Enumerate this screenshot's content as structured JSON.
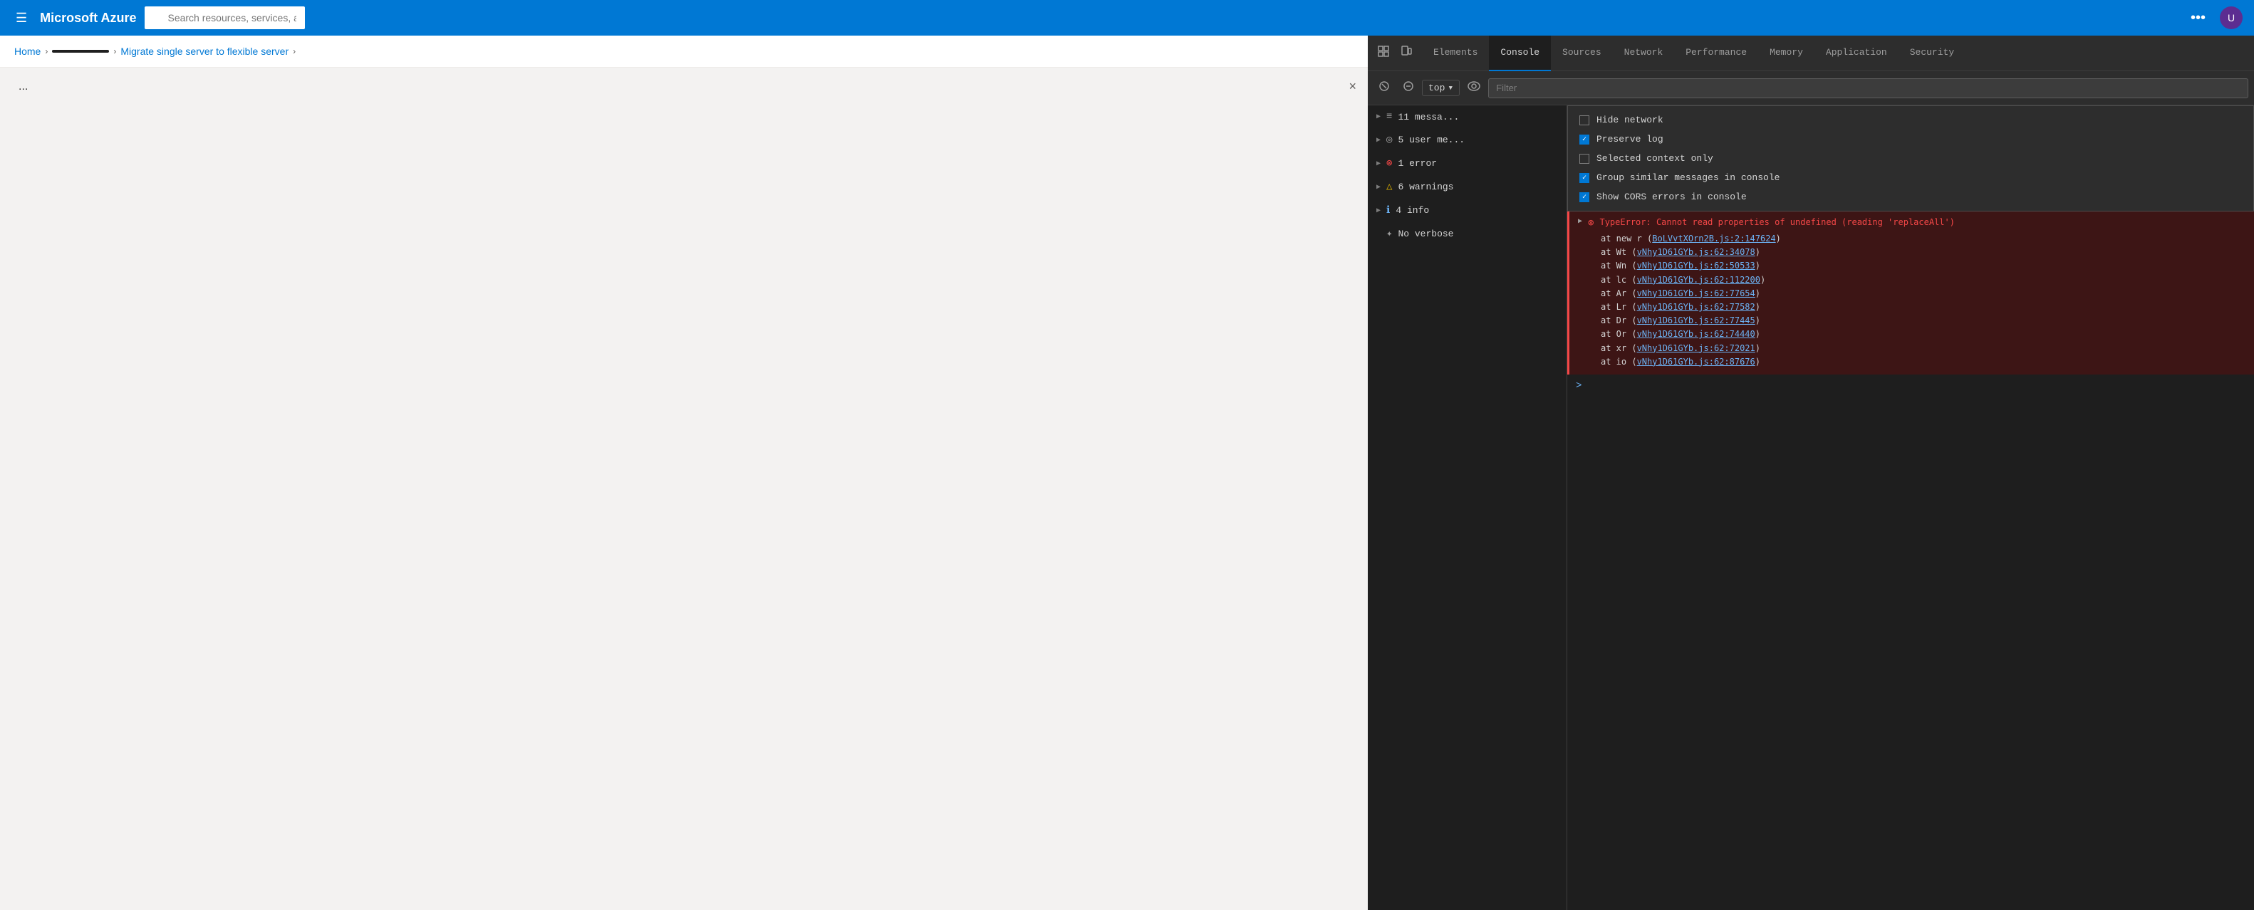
{
  "azure": {
    "topbar": {
      "logo": "Microsoft Azure",
      "search_placeholder": "Search resources, services, and docs (G+/)",
      "more_icon": "•••",
      "avatar_text": "U"
    },
    "breadcrumb": {
      "home": "Home",
      "resource": "[redacted]",
      "page": "Migrate single server to flexible server"
    },
    "page": {
      "ellipsis": "...",
      "close_label": "×"
    }
  },
  "devtools": {
    "tabs": [
      {
        "id": "elements",
        "label": "Elements"
      },
      {
        "id": "console",
        "label": "Console",
        "active": true
      },
      {
        "id": "sources",
        "label": "Sources"
      },
      {
        "id": "network",
        "label": "Network"
      },
      {
        "id": "performance",
        "label": "Performance"
      },
      {
        "id": "memory",
        "label": "Memory"
      },
      {
        "id": "application",
        "label": "Application"
      },
      {
        "id": "security",
        "label": "Security"
      }
    ],
    "toolbar": {
      "top_label": "top",
      "filter_placeholder": "Filter"
    },
    "sidebar_items": [
      {
        "id": "messages",
        "icon": "≡",
        "icon_type": "messages",
        "label": "11 messa..."
      },
      {
        "id": "user",
        "icon": "◎",
        "icon_type": "user",
        "label": "5 user me..."
      },
      {
        "id": "error",
        "icon": "⊗",
        "icon_type": "error",
        "label": "1 error"
      },
      {
        "id": "warning",
        "icon": "△",
        "icon_type": "warning",
        "label": "6 warnings"
      },
      {
        "id": "info",
        "icon": "ℹ",
        "icon_type": "info",
        "label": "4 info"
      },
      {
        "id": "verbose",
        "icon": "✦",
        "icon_type": "verbose",
        "label": "No verbose"
      }
    ],
    "dropdown": {
      "items": [
        {
          "id": "hide-network",
          "label": "Hide network",
          "checked": false
        },
        {
          "id": "preserve-log",
          "label": "Preserve log",
          "checked": true
        },
        {
          "id": "selected-context",
          "label": "Selected context only",
          "checked": false
        },
        {
          "id": "group-similar",
          "label": "Group similar messages in console",
          "checked": true
        },
        {
          "id": "show-cors",
          "label": "Show CORS errors in console",
          "checked": true
        }
      ]
    },
    "error": {
      "message": "TypeError: Cannot read properties of undefined (reading 'replaceAll')",
      "stack": [
        {
          "prefix": "at new r ",
          "link": "BoLVvtXOrn2B.js:2:147624",
          "link_text": "BoLVvtXOrn2B.js:2:147624"
        },
        {
          "prefix": "at Wt ",
          "link": "vNhy1D61GYb.js:62:34078",
          "link_text": "vNhy1D61GYb.js:62:34078"
        },
        {
          "prefix": "at Wn ",
          "link": "vNhy1D61GYb.js:62:50533",
          "link_text": "vNhy1D61GYb.js:62:50533"
        },
        {
          "prefix": "at lc ",
          "link": "vNhy1D61GYb.js:62:112200",
          "link_text": "vNhy1D61GYb.js:62:112200"
        },
        {
          "prefix": "at Ar ",
          "link": "vNhy1D61GYb.js:62:77654",
          "link_text": "vNhy1D61GYb.js:62:77654"
        },
        {
          "prefix": "at Lr ",
          "link": "vNhy1D61GYb.js:62:77582",
          "link_text": "vNhy1D61GYb.js:62:77582"
        },
        {
          "prefix": "at Dr ",
          "link": "vNhy1D61GYb.js:62:77445",
          "link_text": "vNhy1D61GYb.js:62:77445"
        },
        {
          "prefix": "at Or ",
          "link": "vNhy1D61GYb.js:62:74440",
          "link_text": "vNhy1D61GYb.js:62:74440"
        },
        {
          "prefix": "at xr ",
          "link": "vNhy1D61GYb.js:62:72021",
          "link_text": "vNhy1D61GYb.js:62:72021"
        },
        {
          "prefix": "at io ",
          "link": "vNhy1D61GYb.js:62:87676",
          "link_text": "vNhy1D61GYb.js:62:87676"
        }
      ]
    },
    "prompt_arrow": ">"
  }
}
